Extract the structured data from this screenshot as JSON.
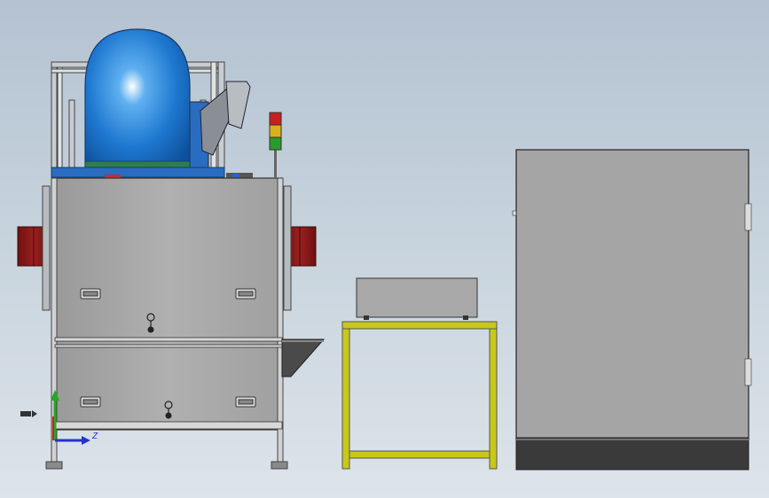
{
  "viewport": {
    "background_top": "#b4c2d2",
    "background_bottom": "#dde4ea"
  },
  "triad": {
    "x_label": "",
    "y_label": "",
    "z_label": "Z",
    "colors": {
      "x": "#cc2222",
      "y": "#22aa22",
      "z": "#2233cc"
    }
  },
  "model": {
    "machine": {
      "body_color": "#a8a8a8",
      "frame_color": "#c0c4c8",
      "hopper_color": "#2a7fd4",
      "side_door_color": "#8b1a1a"
    },
    "signal_tower": {
      "lights": [
        "red",
        "yellow",
        "green"
      ]
    },
    "table": {
      "frame_color": "#c8c81a"
    },
    "cabinet": {
      "body_color": "#a5a5a5",
      "base_color": "#3a3a3a"
    }
  }
}
